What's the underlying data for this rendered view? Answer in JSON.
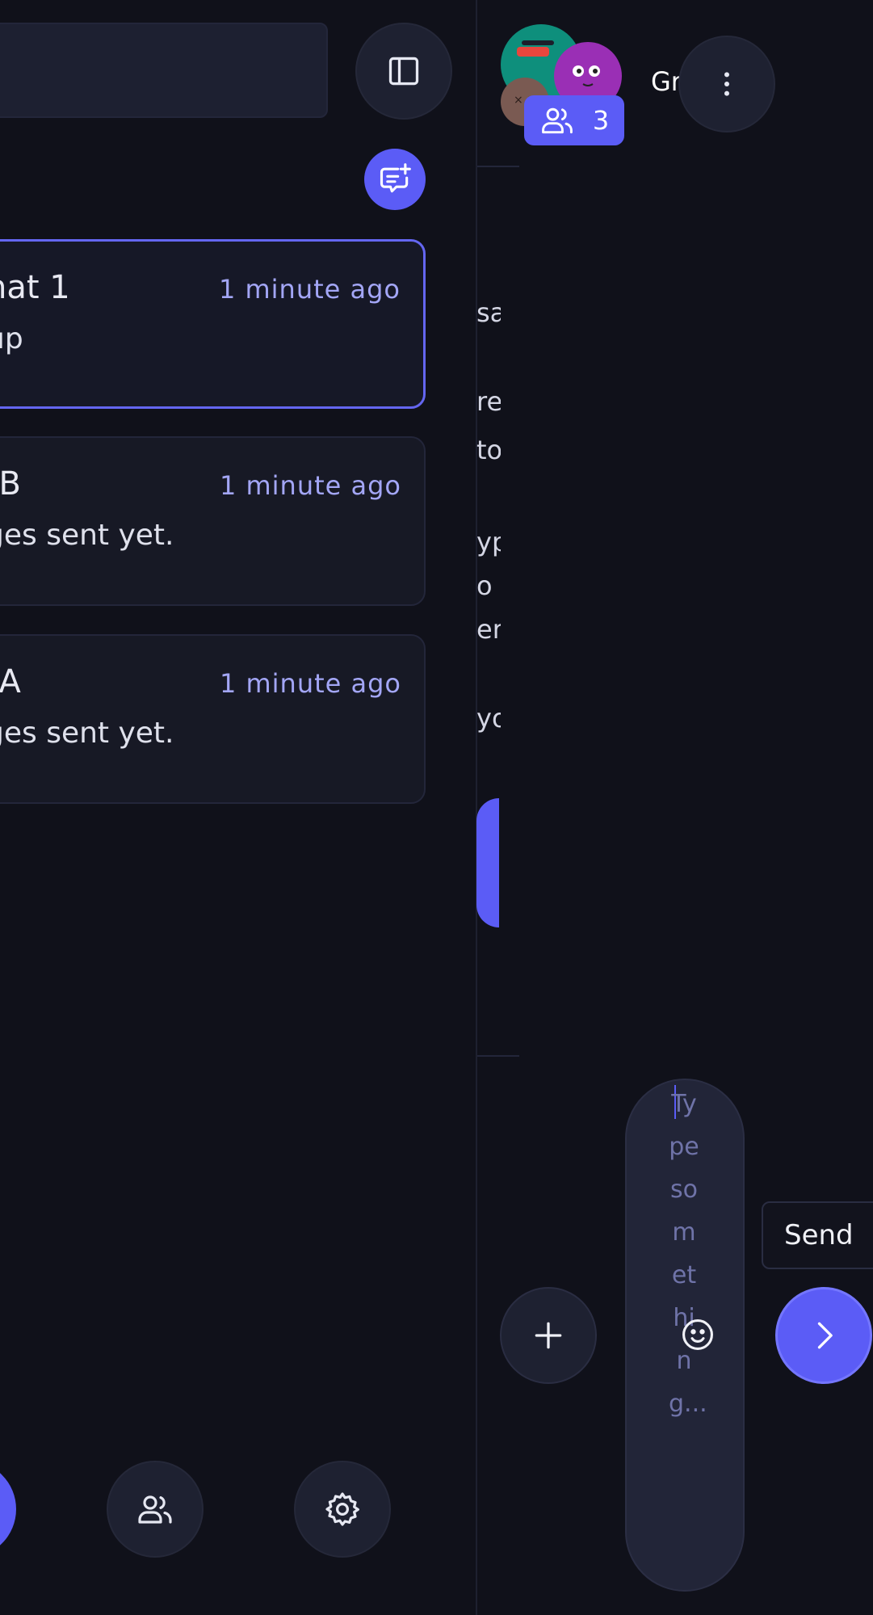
{
  "sidebar": {
    "chats": [
      {
        "title": "hat 1",
        "subtitle": "up",
        "time": "1 minute ago",
        "active": true
      },
      {
        "title": "rB",
        "subtitle": "ges sent yet.",
        "time": "1 minute ago",
        "active": false
      },
      {
        "title": "rA",
        "subtitle": "ges sent yet.",
        "time": "1 minute ago",
        "active": false
      }
    ]
  },
  "header": {
    "group_name": "Gr",
    "member_count": "3"
  },
  "messages": {
    "fragments": [
      "sa",
      "re",
      "to",
      "yp",
      "o",
      "er",
      "yo"
    ]
  },
  "composer": {
    "placeholder": "Type something...",
    "send_tooltip": "Send"
  },
  "colors": {
    "accent": "#5b5cf6",
    "background": "#10111a",
    "card": "#171925",
    "time_text": "#a3a6f6"
  }
}
